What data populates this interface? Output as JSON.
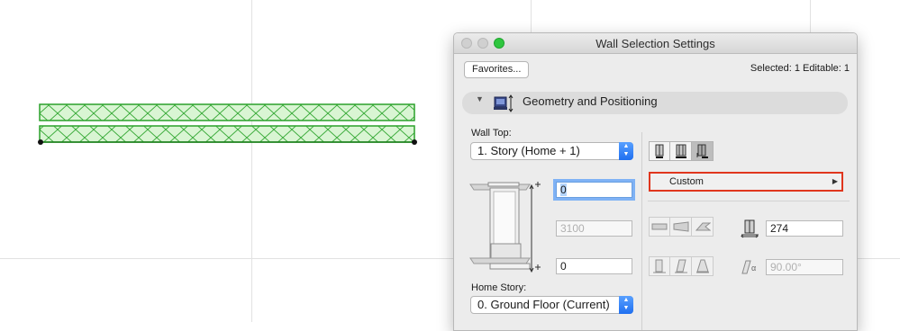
{
  "dialog": {
    "title": "Wall Selection Settings",
    "favorites_label": "Favorites...",
    "selection_info": "Selected: 1 Editable: 1"
  },
  "section": {
    "title": "Geometry and Positioning",
    "expanded_icon": "disclosure-triangle-down-icon",
    "icon": "wall-geometry-icon"
  },
  "wall_top": {
    "label": "Wall Top:",
    "selected": "1. Story (Home + 1)"
  },
  "top_offset": {
    "value": "0"
  },
  "height": {
    "value": "3100"
  },
  "bottom_offset": {
    "value": "0"
  },
  "home_story": {
    "label": "Home Story:",
    "selected": "0. Ground Floor (Current)"
  },
  "reference_line": {
    "selected": "Custom"
  },
  "thickness": {
    "value": "274"
  },
  "slant_angle": {
    "value": "90.00°"
  },
  "colors": {
    "wall_fill": "#d9f5d3",
    "wall_stroke": "#2aa12a",
    "highlight": "#e0361e",
    "accent": "#1f6ff0"
  }
}
